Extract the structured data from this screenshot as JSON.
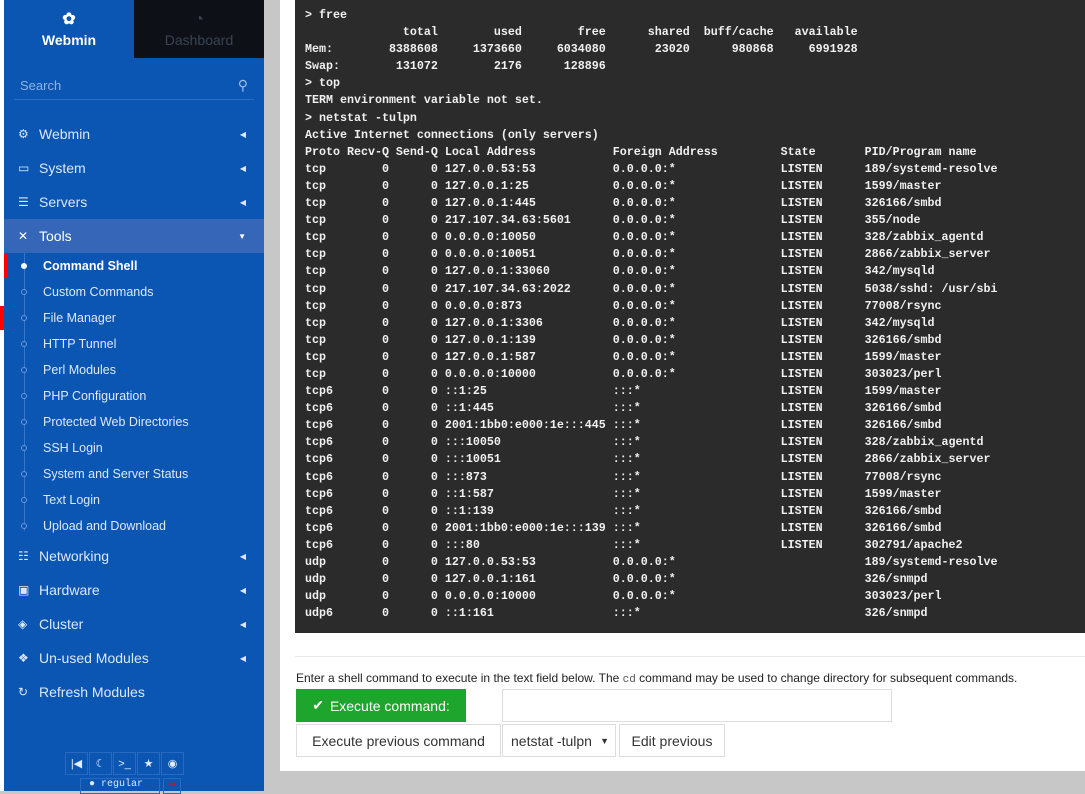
{
  "sidebar": {
    "brand_label": "Webmin",
    "dashboard_label": "Dashboard",
    "search_placeholder": "Search",
    "menu": [
      {
        "label": "Webmin",
        "icon": "gear-icon"
      },
      {
        "label": "System",
        "icon": "laptop-icon"
      },
      {
        "label": "Servers",
        "icon": "server-icon"
      },
      {
        "label": "Tools",
        "icon": "tools-icon"
      }
    ],
    "tools_items": [
      "Command Shell",
      "Custom Commands",
      "File Manager",
      "HTTP Tunnel",
      "Perl Modules",
      "PHP Configuration",
      "Protected Web Directories",
      "SSH Login",
      "System and Server Status",
      "Text Login",
      "Upload and Download"
    ],
    "active_item": "Command Shell",
    "menu_after": [
      {
        "label": "Networking",
        "icon": "network-icon"
      },
      {
        "label": "Hardware",
        "icon": "hdd-icon"
      },
      {
        "label": "Cluster",
        "icon": "layers-icon"
      },
      {
        "label": "Un-used Modules",
        "icon": "puzzle-icon"
      },
      {
        "label": "Refresh Modules",
        "icon": "refresh-icon"
      }
    ],
    "footer_user": "regular"
  },
  "terminal": {
    "cmd_free": "> free",
    "free_headers": [
      "total",
      "used",
      "free",
      "shared",
      "buff/cache",
      "available"
    ],
    "free_rows": [
      {
        "label": "Mem:",
        "values": [
          "8388608",
          "1373660",
          "6034080",
          "23020",
          "980868",
          "6991928"
        ]
      },
      {
        "label": "Swap:",
        "values": [
          "131072",
          "2176",
          "128896"
        ]
      }
    ],
    "cmd_top": "> top",
    "top_output": "TERM environment variable not set.",
    "cmd_netstat": "> netstat -tulpn",
    "netstat_title": "Active Internet connections (only servers)",
    "netstat_headers": [
      "Proto",
      "Recv-Q",
      "Send-Q",
      "Local Address",
      "Foreign Address",
      "State",
      "PID/Program name"
    ],
    "netstat_rows": [
      [
        "tcp",
        "0",
        "0",
        "127.0.0.53:53",
        "0.0.0.0:*",
        "LISTEN",
        "189/systemd-resolve"
      ],
      [
        "tcp",
        "0",
        "0",
        "127.0.0.1:25",
        "0.0.0.0:*",
        "LISTEN",
        "1599/master"
      ],
      [
        "tcp",
        "0",
        "0",
        "127.0.0.1:445",
        "0.0.0.0:*",
        "LISTEN",
        "326166/smbd"
      ],
      [
        "tcp",
        "0",
        "0",
        "217.107.34.63:5601",
        "0.0.0.0:*",
        "LISTEN",
        "355/node"
      ],
      [
        "tcp",
        "0",
        "0",
        "0.0.0.0:10050",
        "0.0.0.0:*",
        "LISTEN",
        "328/zabbix_agentd"
      ],
      [
        "tcp",
        "0",
        "0",
        "0.0.0.0:10051",
        "0.0.0.0:*",
        "LISTEN",
        "2866/zabbix_server"
      ],
      [
        "tcp",
        "0",
        "0",
        "127.0.0.1:33060",
        "0.0.0.0:*",
        "LISTEN",
        "342/mysqld"
      ],
      [
        "tcp",
        "0",
        "0",
        "217.107.34.63:2022",
        "0.0.0.0:*",
        "LISTEN",
        "5038/sshd: /usr/sbi"
      ],
      [
        "tcp",
        "0",
        "0",
        "0.0.0.0:873",
        "0.0.0.0:*",
        "LISTEN",
        "77008/rsync"
      ],
      [
        "tcp",
        "0",
        "0",
        "127.0.0.1:3306",
        "0.0.0.0:*",
        "LISTEN",
        "342/mysqld"
      ],
      [
        "tcp",
        "0",
        "0",
        "127.0.0.1:139",
        "0.0.0.0:*",
        "LISTEN",
        "326166/smbd"
      ],
      [
        "tcp",
        "0",
        "0",
        "127.0.0.1:587",
        "0.0.0.0:*",
        "LISTEN",
        "1599/master"
      ],
      [
        "tcp",
        "0",
        "0",
        "0.0.0.0:10000",
        "0.0.0.0:*",
        "LISTEN",
        "303023/perl"
      ],
      [
        "tcp6",
        "0",
        "0",
        "::1:25",
        ":::*",
        "LISTEN",
        "1599/master"
      ],
      [
        "tcp6",
        "0",
        "0",
        "::1:445",
        ":::*",
        "LISTEN",
        "326166/smbd"
      ],
      [
        "tcp6",
        "0",
        "0",
        "2001:1bb0:e000:1e:::445",
        ":::*",
        "LISTEN",
        "326166/smbd"
      ],
      [
        "tcp6",
        "0",
        "0",
        ":::10050",
        ":::*",
        "LISTEN",
        "328/zabbix_agentd"
      ],
      [
        "tcp6",
        "0",
        "0",
        ":::10051",
        ":::*",
        "LISTEN",
        "2866/zabbix_server"
      ],
      [
        "tcp6",
        "0",
        "0",
        ":::873",
        ":::*",
        "LISTEN",
        "77008/rsync"
      ],
      [
        "tcp6",
        "0",
        "0",
        "::1:587",
        ":::*",
        "LISTEN",
        "1599/master"
      ],
      [
        "tcp6",
        "0",
        "0",
        "::1:139",
        ":::*",
        "LISTEN",
        "326166/smbd"
      ],
      [
        "tcp6",
        "0",
        "0",
        "2001:1bb0:e000:1e:::139",
        ":::*",
        "LISTEN",
        "326166/smbd"
      ],
      [
        "tcp6",
        "0",
        "0",
        ":::80",
        ":::*",
        "LISTEN",
        "302791/apache2"
      ],
      [
        "udp",
        "0",
        "0",
        "127.0.0.53:53",
        "0.0.0.0:*",
        "",
        "189/systemd-resolve"
      ],
      [
        "udp",
        "0",
        "0",
        "127.0.0.1:161",
        "0.0.0.0:*",
        "",
        "326/snmpd"
      ],
      [
        "udp",
        "0",
        "0",
        "0.0.0.0:10000",
        "0.0.0.0:*",
        "",
        "303023/perl"
      ],
      [
        "udp6",
        "0",
        "0",
        "::1:161",
        ":::*",
        "",
        "326/snmpd"
      ]
    ]
  },
  "form": {
    "hint_before": "Enter a shell command to execute in the text field below. The ",
    "hint_code": "cd",
    "hint_after": " command may be used to change directory for subsequent commands.",
    "execute_label": "Execute command:",
    "command_value": "",
    "execute_previous_label": "Execute previous command",
    "previous_selected": "netstat -tulpn",
    "edit_previous_label": "Edit previous"
  },
  "colors": {
    "sidebar": "#0b56b3",
    "terminal_bg": "#2b2b2b",
    "execute_button": "#1ea52d",
    "active_marker": "#ff0000"
  }
}
